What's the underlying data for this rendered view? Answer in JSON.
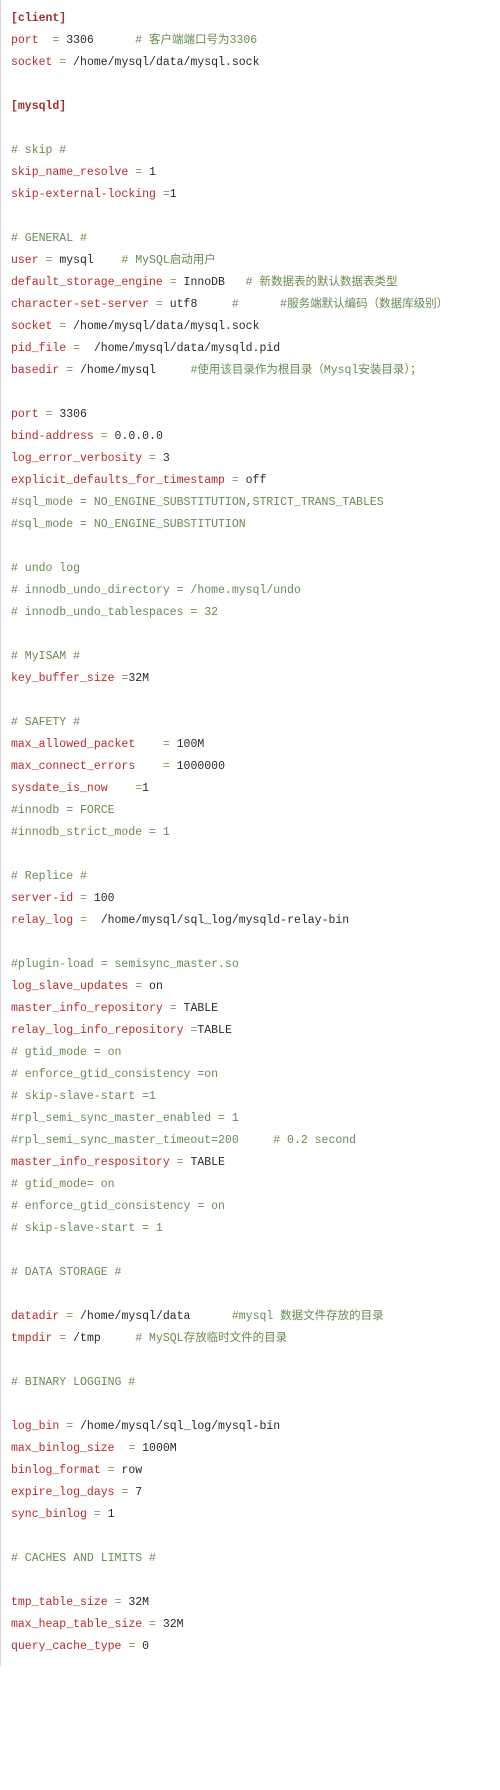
{
  "client": {
    "section": "[client]",
    "port_key": "port",
    "port_eq": "  = ",
    "port_val": "3306",
    "port_comment": "      # 客户端端口号为3306",
    "socket_key": "socket",
    "socket_eq": " = ",
    "socket_val": "/home/mysql/data/mysql.sock"
  },
  "mysqld": {
    "section": "[mysqld]"
  },
  "skip": {
    "title": "# skip #",
    "l1_key": "skip_name_resolve",
    "l1_eq": " = ",
    "l1_val": "1",
    "l2_key": "skip-external-locking",
    "l2_eq": " =",
    "l2_val": "1"
  },
  "general": {
    "title": "# GENERAL #",
    "user_key": "user",
    "user_eq": " = ",
    "user_val": "mysql",
    "user_cmt": "    # MySQL启动用户",
    "eng_key": "default_storage_engine",
    "eng_eq": " = ",
    "eng_val": "InnoDB",
    "eng_cmt": "   # 新数据表的默认数据表类型",
    "charset_key": "character-set-server",
    "charset_eq": " = ",
    "charset_val": "utf8",
    "charset_cmt": "     #      #服务端默认编码（数据库级别）",
    "sock_key": "socket",
    "sock_eq": " = ",
    "sock_val": "/home/mysql/data/mysql.sock",
    "pid_key": "pid_file",
    "pid_eq": " =  ",
    "pid_val": "/home/mysql/data/mysqld.pid",
    "base_key": "basedir",
    "base_eq": " = ",
    "base_val": "/home/mysql",
    "base_cmt": "     #使用该目录作为根目录（Mysql安装目录）；"
  },
  "net": {
    "port_key": "port",
    "port_eq": " = ",
    "port_val": "3306",
    "bind_key": "bind-address",
    "bind_eq": " = ",
    "bind_val": "0.0.0.0",
    "verb_key": "log_error_verbosity",
    "verb_eq": " = ",
    "verb_val": "3",
    "expl_key": "explicit_defaults_for_timestamp",
    "expl_eq": " = ",
    "expl_val": "off",
    "sql1": "#sql_mode = NO_ENGINE_SUBSTITUTION,STRICT_TRANS_TABLES",
    "sql2": "#sql_mode = NO_ENGINE_SUBSTITUTION"
  },
  "undo": {
    "l1": "# undo log",
    "l2": "# innodb_undo_directory = /home.mysql/undo",
    "l3": "# innodb_undo_tablespaces = 32"
  },
  "myisam": {
    "title": "# MyISAM #",
    "key": "key_buffer_size",
    "eq": " =",
    "val": "32M"
  },
  "safety": {
    "title": "# SAFETY #",
    "map_key": "max_allowed_packet",
    "map_eq": "    = ",
    "map_val": "100M",
    "mce_key": "max_connect_errors",
    "mce_eq": "    = ",
    "mce_val": "1000000",
    "sys_key": "sysdate_is_now",
    "sys_eq": "    =",
    "sys_val": "1",
    "inn1": "#innodb = FORCE",
    "inn2": "#innodb_strict_mode = 1"
  },
  "replice": {
    "title": "# Replice #",
    "sid_key": "server-id",
    "sid_eq": " = ",
    "sid_val": "100",
    "relay_key": "relay_log",
    "relay_eq": " =  ",
    "relay_val": "/home/mysql/sql_log/mysqld-relay-bin",
    "plugin": "#plugin-load = semisync_master.so",
    "lsu_key": "log_slave_updates",
    "lsu_eq": " = ",
    "lsu_val": "on",
    "mir_key": "master_info_repository",
    "mir_eq": " = ",
    "mir_val": "TABLE",
    "rli_key": "relay_log_info_repository",
    "rli_eq": " =",
    "rli_val": "TABLE",
    "gtid": "# gtid_mode = on",
    "egc": "# enforce_gtid_consistency =on",
    "sss": "# skip-slave-start =1",
    "rse": "#rpl_semi_sync_master_enabled = 1",
    "rst": "#rpl_semi_sync_master_timeout=200     # 0.2 second",
    "mir2_key": "master_info_respository",
    "mir2_eq": " = ",
    "mir2_val": "TABLE",
    "gtid2": "# gtid_mode= on",
    "egc2": "# enforce_gtid_consistency = on",
    "sss2": "# skip-slave-start = 1"
  },
  "storage": {
    "title": "# DATA STORAGE #",
    "dd_key": "datadir",
    "dd_eq": " = ",
    "dd_val": "/home/mysql/data",
    "dd_cmt": "      #mysql 数据文件存放的目录",
    "tmp_key": "tmpdir",
    "tmp_eq": " = ",
    "tmp_val": "/tmp",
    "tmp_cmt": "     # MySQL存放临时文件的目录"
  },
  "binlog": {
    "title": "# BINARY LOGGING #",
    "lb_key": "log_bin",
    "lb_eq": " = ",
    "lb_val": "/home/mysql/sql_log/mysql-bin",
    "mbs_key": "max_binlog_size",
    "mbs_eq": "  = ",
    "mbs_val": "1000M",
    "bf_key": "binlog_format",
    "bf_eq": " = ",
    "bf_val": "row",
    "eld_key": "expire_log_days",
    "eld_eq": " = ",
    "eld_val": "7",
    "sb_key": "sync_binlog",
    "sb_eq": " = ",
    "sb_val": "1"
  },
  "caches": {
    "title": "# CACHES AND LIMITS #",
    "tts_key": "tmp_table_size",
    "tts_eq": " = ",
    "tts_val": "32M",
    "mht_key": "max_heap_table_size",
    "mht_eq": " = ",
    "mht_val": "32M",
    "qct_key": "query_cache_type",
    "qct_eq": " = ",
    "qct_val": "0"
  }
}
